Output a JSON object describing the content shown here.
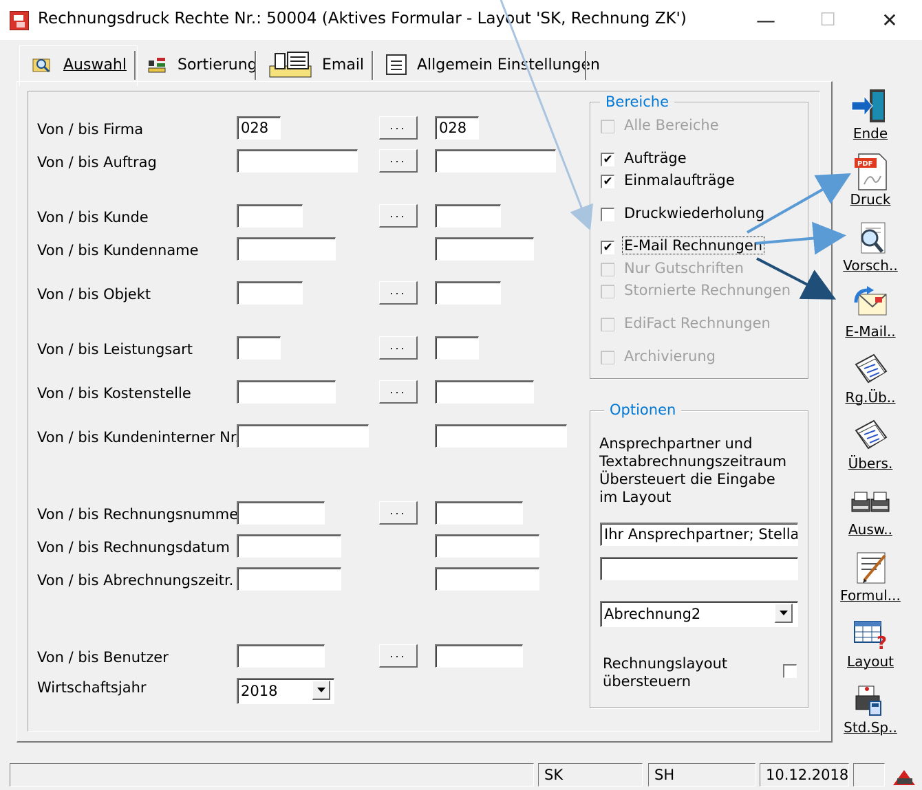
{
  "window": {
    "title": "Rechnungsdruck Rechte Nr.: 50004    (Aktives Formular - Layout 'SK, Rechnung ZK')",
    "minimize": "—",
    "maximize": "☐",
    "close": "✕"
  },
  "tabs": [
    {
      "label": "Auswahl",
      "icon": "search-folder-icon",
      "active": true
    },
    {
      "label": "Sortierung",
      "icon": "sort-icon",
      "active": false
    },
    {
      "label": "Email",
      "icon": "email-form-icon",
      "active": false
    },
    {
      "label": "Allgemein Einstellungen",
      "icon": "settings-doc-icon",
      "active": false
    }
  ],
  "form": {
    "rows": [
      {
        "label": "Von / bis Firma",
        "from": "028",
        "to": "028",
        "lookup": true
      },
      {
        "label": "Von / bis Auftrag",
        "from": "",
        "to": "",
        "lookup": true
      },
      {
        "label": "Von / bis Kunde",
        "from": "",
        "to": "",
        "lookup": true
      },
      {
        "label": "Von / bis Kundenname",
        "from": "",
        "to": "",
        "lookup": false
      },
      {
        "label": "Von / bis Objekt",
        "from": "",
        "to": "",
        "lookup": true
      },
      {
        "label": "Von / bis Leistungsart",
        "from": "",
        "to": "",
        "lookup": true
      },
      {
        "label": "Von / bis Kostenstelle",
        "from": "",
        "to": "",
        "lookup": true
      },
      {
        "label": "Von / bis Kundeninterner Nr.",
        "from": "",
        "to": "",
        "lookup": false
      },
      {
        "label": "Von / bis Rechnungsnummer",
        "from": "",
        "to": "",
        "lookup": true
      },
      {
        "label": "Von / bis Rechnungsdatum",
        "from": "",
        "to": "",
        "lookup": false
      },
      {
        "label": "Von / bis Abrechnungszeitr.",
        "from": "",
        "to": "",
        "lookup": false
      },
      {
        "label": "Von / bis Benutzer",
        "from": "",
        "to": "",
        "lookup": true
      }
    ],
    "lookup_label": "...",
    "wirtschaftsjahr": {
      "label": "Wirtschaftsjahr",
      "value": "2018"
    }
  },
  "bereiche": {
    "title": "Bereiche",
    "items": [
      {
        "label": "Alle Bereiche",
        "checked": false,
        "enabled": false
      },
      {
        "label": "Aufträge",
        "checked": true,
        "enabled": true
      },
      {
        "label": "Einmalaufträge",
        "checked": true,
        "enabled": true
      },
      {
        "label": "Druckwiederholung",
        "checked": false,
        "enabled": true
      },
      {
        "label": "E-Mail Rechnungen",
        "checked": true,
        "enabled": true
      },
      {
        "label": "Nur Gutschriften",
        "checked": false,
        "enabled": false
      },
      {
        "label": "Stornierte Rechnungen",
        "checked": false,
        "enabled": false
      },
      {
        "label": "EdiFact Rechnungen",
        "checked": false,
        "enabled": false
      },
      {
        "label": "Archivierung",
        "checked": false,
        "enabled": false
      }
    ]
  },
  "optionen": {
    "title": "Optionen",
    "description": "Ansprechpartner und Textabrechnungszeitraum Übersteuert die Eingabe im Layout",
    "ansprechpartner": "Ihr Ansprechpartner; Stella Ka",
    "zeitraum": "",
    "layout_select": "Abrechnung2",
    "override_label": "Rechnungslayout übersteuern",
    "override_checked": false
  },
  "toolbar": [
    {
      "label": "Ende",
      "icon": "exit-door-icon"
    },
    {
      "label": "Druck",
      "icon": "pdf-icon"
    },
    {
      "label": "Vorsch..",
      "icon": "preview-magnifier-icon"
    },
    {
      "label": "E-Mail..",
      "icon": "email-envelope-icon"
    },
    {
      "label": "Rg.Üb..",
      "icon": "invoice-overview-icon"
    },
    {
      "label": "Übers.",
      "icon": "overview-icon"
    },
    {
      "label": "Ausw..",
      "icon": "printers-icon"
    },
    {
      "label": "Formul...",
      "icon": "form-edit-icon"
    },
    {
      "label": "Layout",
      "icon": "layout-table-icon"
    },
    {
      "label": "Std.Sp..",
      "icon": "std-print-icon"
    }
  ],
  "status": {
    "field1": "",
    "user": "SK",
    "user2": "SH",
    "date": "10.12.2018",
    "empty": ""
  },
  "colors": {
    "group_title": "#0078d7",
    "arrow_light": "#5b9bd5",
    "arrow_dark": "#1f4e79"
  }
}
